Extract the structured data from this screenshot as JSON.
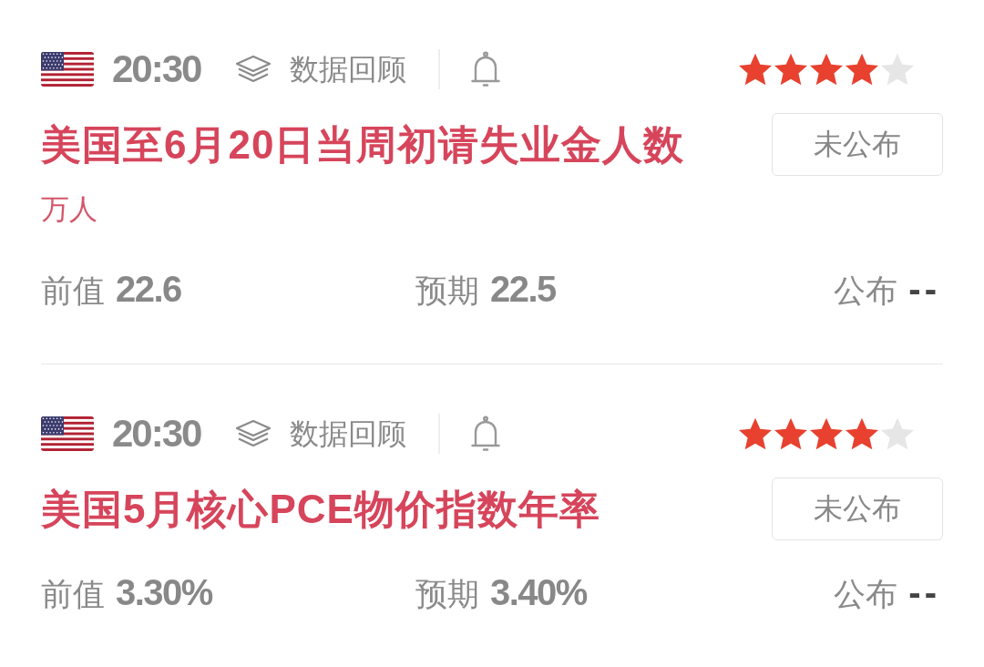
{
  "events": [
    {
      "time": "20:30",
      "review": "数据回顾",
      "stars": 4,
      "title": "美国至6月20日当周初请失业金人数",
      "status": "未公布",
      "unit": "万人",
      "figures": [
        {
          "label": "前值",
          "value": "22.6"
        },
        {
          "label": "预期",
          "value": "22.5"
        },
        {
          "label": "公布",
          "value": "--"
        }
      ]
    },
    {
      "time": "20:30",
      "review": "数据回顾",
      "stars": 4,
      "title": "美国5月核心PCE物价指数年率",
      "status": "未公布",
      "figures": [
        {
          "label": "前值",
          "value": "3.30%"
        },
        {
          "label": "预期",
          "value": "3.40%"
        },
        {
          "label": "公布",
          "value": "--"
        }
      ]
    }
  ]
}
